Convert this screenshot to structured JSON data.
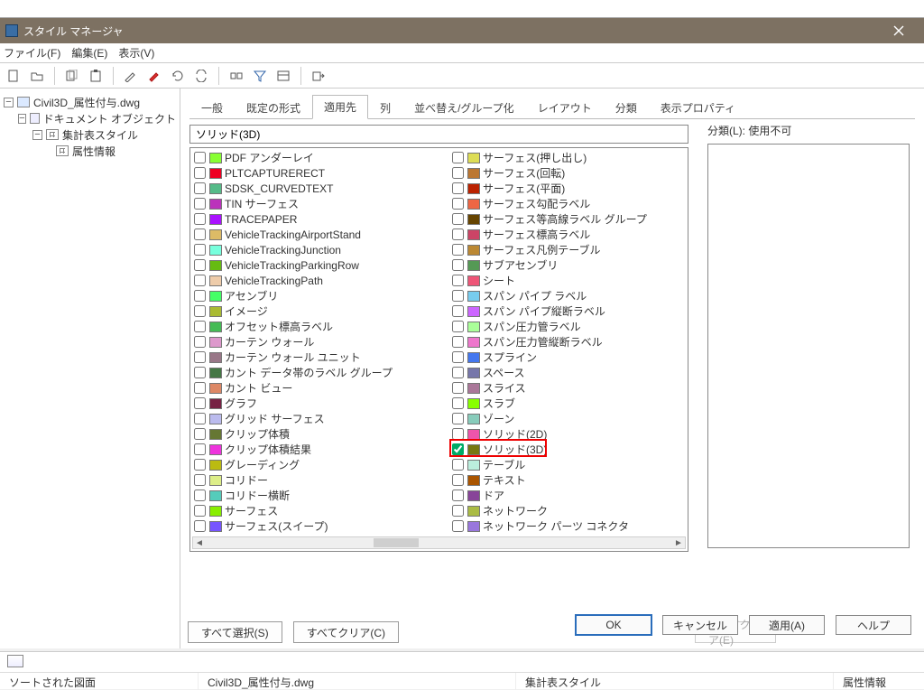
{
  "window": {
    "title": "スタイル マネージャ"
  },
  "menus": {
    "file": "ファイル(F)",
    "edit": "編集(E)",
    "view": "表示(V)"
  },
  "tree": {
    "root": "Civil3D_属性付与.dwg",
    "n1": "ドキュメント オブジェクト",
    "n2": "集計表スタイル",
    "n3": "属性情報"
  },
  "tabs": {
    "general": "一般",
    "defaults": "既定の形式",
    "apply": "適用先",
    "columns": "列",
    "sort": "並べ替え/グループ化",
    "layout": "レイアウト",
    "classify": "分類",
    "display": "表示プロパティ"
  },
  "filter": {
    "value": "ソリッド(3D)"
  },
  "right": {
    "label": "分類(L): 使用不可"
  },
  "leftItems": [
    "PDF アンダーレイ",
    "PLTCAPTURERECT",
    "SDSK_CURVEDTEXT",
    "TIN サーフェス",
    "TRACEPAPER",
    "VehicleTrackingAirportStand",
    "VehicleTrackingJunction",
    "VehicleTrackingParkingRow",
    "VehicleTrackingPath",
    "アセンブリ",
    "イメージ",
    "オフセット標高ラベル",
    "カーテン ウォール",
    "カーテン ウォール ユニット",
    "カント データ帯のラベル グループ",
    "カント ビュー",
    "グラフ",
    "グリッド サーフェス",
    "クリップ体積",
    "クリップ体積結果",
    "グレーディング",
    "コリドー",
    "コリドー横断",
    "サーフェス",
    "サーフェス(スイープ)"
  ],
  "rightItems": [
    "サーフェス(押し出し)",
    "サーフェス(回転)",
    "サーフェス(平面)",
    "サーフェス勾配ラベル",
    "サーフェス等高線ラベル グループ",
    "サーフェス標高ラベル",
    "サーフェス凡例テーブル",
    "サブアセンブリ",
    "シート",
    "スパン パイプ ラベル",
    "スパン パイプ縦断ラベル",
    "スパン圧力管ラベル",
    "スパン圧力管縦断ラベル",
    "スプライン",
    "スペース",
    "スライス",
    "スラブ",
    "ゾーン",
    "ソリッド(2D)",
    "ソリッド(3D)",
    "テーブル",
    "テキスト",
    "ドア",
    "ネットワーク",
    "ネットワーク パーツ コネクタ"
  ],
  "checkedRight": 19,
  "buttons": {
    "selectAll": "すべて選択(S)",
    "clearAll": "すべてクリア(C)",
    "clearAllE": "すべてクリア(E)",
    "ok": "OK",
    "cancel": "キャンセル",
    "apply": "適用(A)",
    "help": "ヘルプ"
  },
  "status": {
    "a": "ソートされた図面",
    "b": "Civil3D_属性付与.dwg",
    "c": "集計表スタイル",
    "d": "属性情報"
  },
  "iconColors": {
    "pdf": "#e06",
    "brush": "#c00",
    "tin": "#b84",
    "img": "#5bd",
    "grid": "#888",
    "hatch": "#9b7",
    "surf": "#e90",
    "disk": "#6ad",
    "sheet": "#fff",
    "spline": "#6ad",
    "space": "#49c",
    "zone": "#7b5",
    "door": "#bca"
  }
}
